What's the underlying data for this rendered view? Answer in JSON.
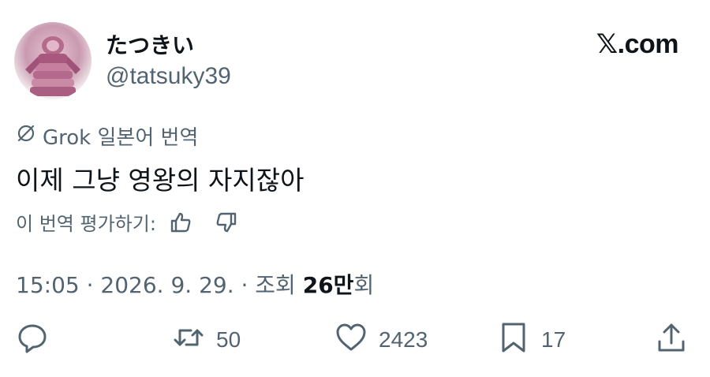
{
  "author": {
    "display_name": "たつきい",
    "handle": "@tatsuky39"
  },
  "brand": {
    "logo_text": "𝕏.com"
  },
  "translation": {
    "label": "Grok 일본어 번역",
    "icon": "grok-icon"
  },
  "tweet": {
    "text": "이제 그냥 영왕의 자지잖아"
  },
  "rate_translation": {
    "label": "이 번역 평가하기:",
    "icons": [
      "thumbs-up-icon",
      "thumbs-down-icon"
    ]
  },
  "meta": {
    "time_date": "15:05 · 2026. 9. 29. · 조회 ",
    "views_number": "26만",
    "views_suffix": "회"
  },
  "actions": {
    "reply_count": "",
    "retweet_count": "50",
    "like_count": "2423",
    "bookmark_count": "17"
  },
  "colors": {
    "primary_text": "#0f1419",
    "secondary_text": "#536471",
    "background": "#ffffff"
  }
}
